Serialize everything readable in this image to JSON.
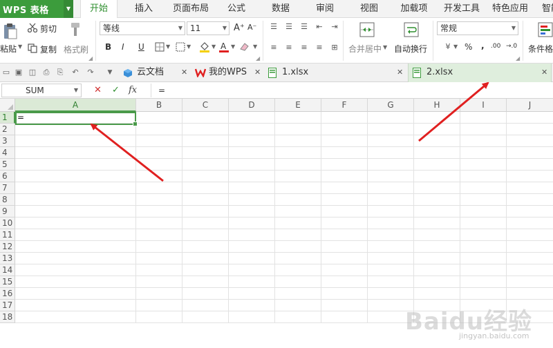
{
  "app": {
    "name": "WPS 表格"
  },
  "menu": [
    "开始",
    "插入",
    "页面布局",
    "公式",
    "数据",
    "审阅",
    "视图",
    "加载项",
    "开发工具",
    "特色应用",
    "智能"
  ],
  "ribbon": {
    "paste": "粘贴",
    "cut": "剪切",
    "copy": "复制",
    "format_painter": "格式刷",
    "font_name": "等线",
    "font_size": "11",
    "font_grow": "A⁺",
    "font_shrink": "A⁻",
    "bold": "B",
    "italic": "I",
    "underline": "U",
    "merge_center": "合并居中",
    "wrap_text": "自动换行",
    "number_format": "常规",
    "percent": "%",
    "comma": ",",
    "inc_decimal": ".00",
    "dec_decimal": "→.0",
    "conditional_format": "条件格"
  },
  "doc_tabs": [
    {
      "label": "云文档",
      "icon": "cloud-doc-icon"
    },
    {
      "label": "我的WPS",
      "icon": "wps-logo-icon"
    },
    {
      "label": "1.xlsx",
      "icon": "sheet-file-icon"
    },
    {
      "label": "2.xlsx",
      "icon": "sheet-file-icon",
      "active": true
    }
  ],
  "formula_bar": {
    "name_box": "SUM",
    "cancel": "✕",
    "confirm": "✓",
    "fx": "fx",
    "content": "="
  },
  "grid": {
    "columns": [
      "A",
      "B",
      "C",
      "D",
      "E",
      "F",
      "G",
      "H",
      "I",
      "J"
    ],
    "rows": [
      "1",
      "2",
      "3",
      "4",
      "5",
      "6",
      "7",
      "8",
      "9",
      "10",
      "11",
      "12",
      "13",
      "14",
      "15",
      "16",
      "17",
      "18"
    ],
    "active_cell": "A1",
    "active_cell_value": "="
  },
  "watermark": {
    "brand": "Baidu经验",
    "url": "jingyan.baidu.com"
  },
  "colors": {
    "brand_green": "#3c9c3c",
    "select_green": "#4a9a4a",
    "arrow_red": "#e02020"
  }
}
